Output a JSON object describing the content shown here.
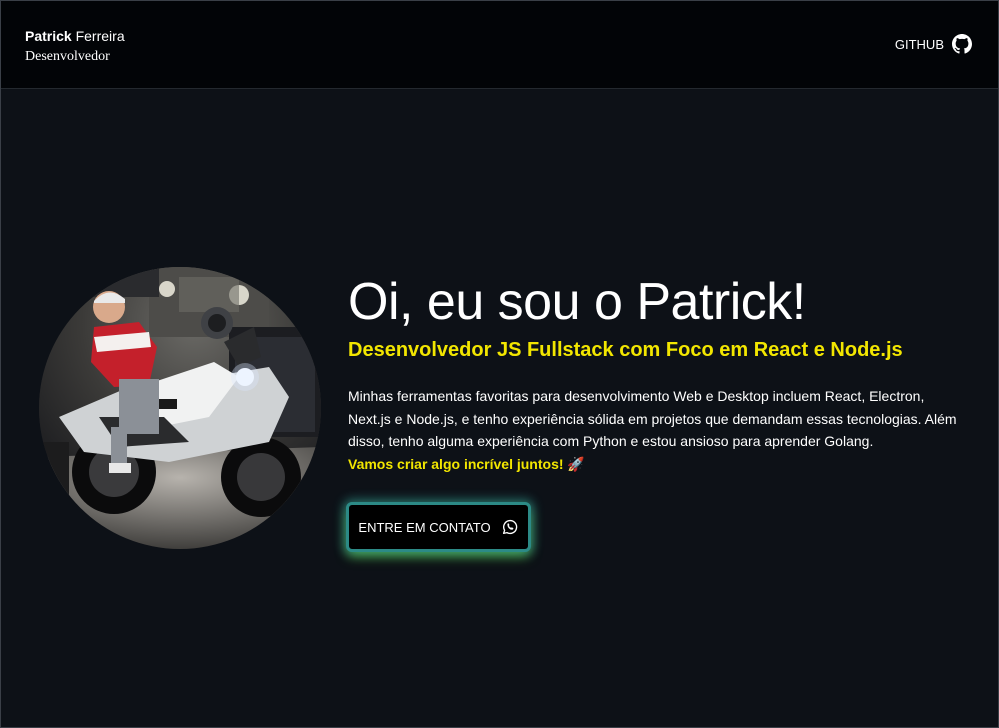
{
  "header": {
    "brand_first": "Patrick",
    "brand_last": "Ferreira",
    "brand_role": "Desenvolvedor",
    "github_label": "GITHUB",
    "github_icon": "github-icon"
  },
  "hero": {
    "title": "Oi, eu sou o Patrick!",
    "subtitle": "Desenvolvedor JS Fullstack com Foco em React e Node.js",
    "description": "Minhas ferramentas favoritas para desenvolvimento Web e Desktop incluem React, Electron, Next.js e Node.js, e tenho experiência sólida em projetos que demandam essas tecnologias. Além disso, tenho alguma experiência com Python e estou ansioso para aprender Golang.",
    "cta_text": "Vamos criar algo incrível juntos! 🚀",
    "contact_button": "ENTRE EM CONTATO",
    "contact_icon": "whatsapp-icon",
    "avatar_icon": "profile-photo"
  },
  "colors": {
    "background": "#0d1117",
    "header_background": "#020407",
    "accent_yellow": "#f2e600",
    "button_glow": "#2c8a86"
  }
}
